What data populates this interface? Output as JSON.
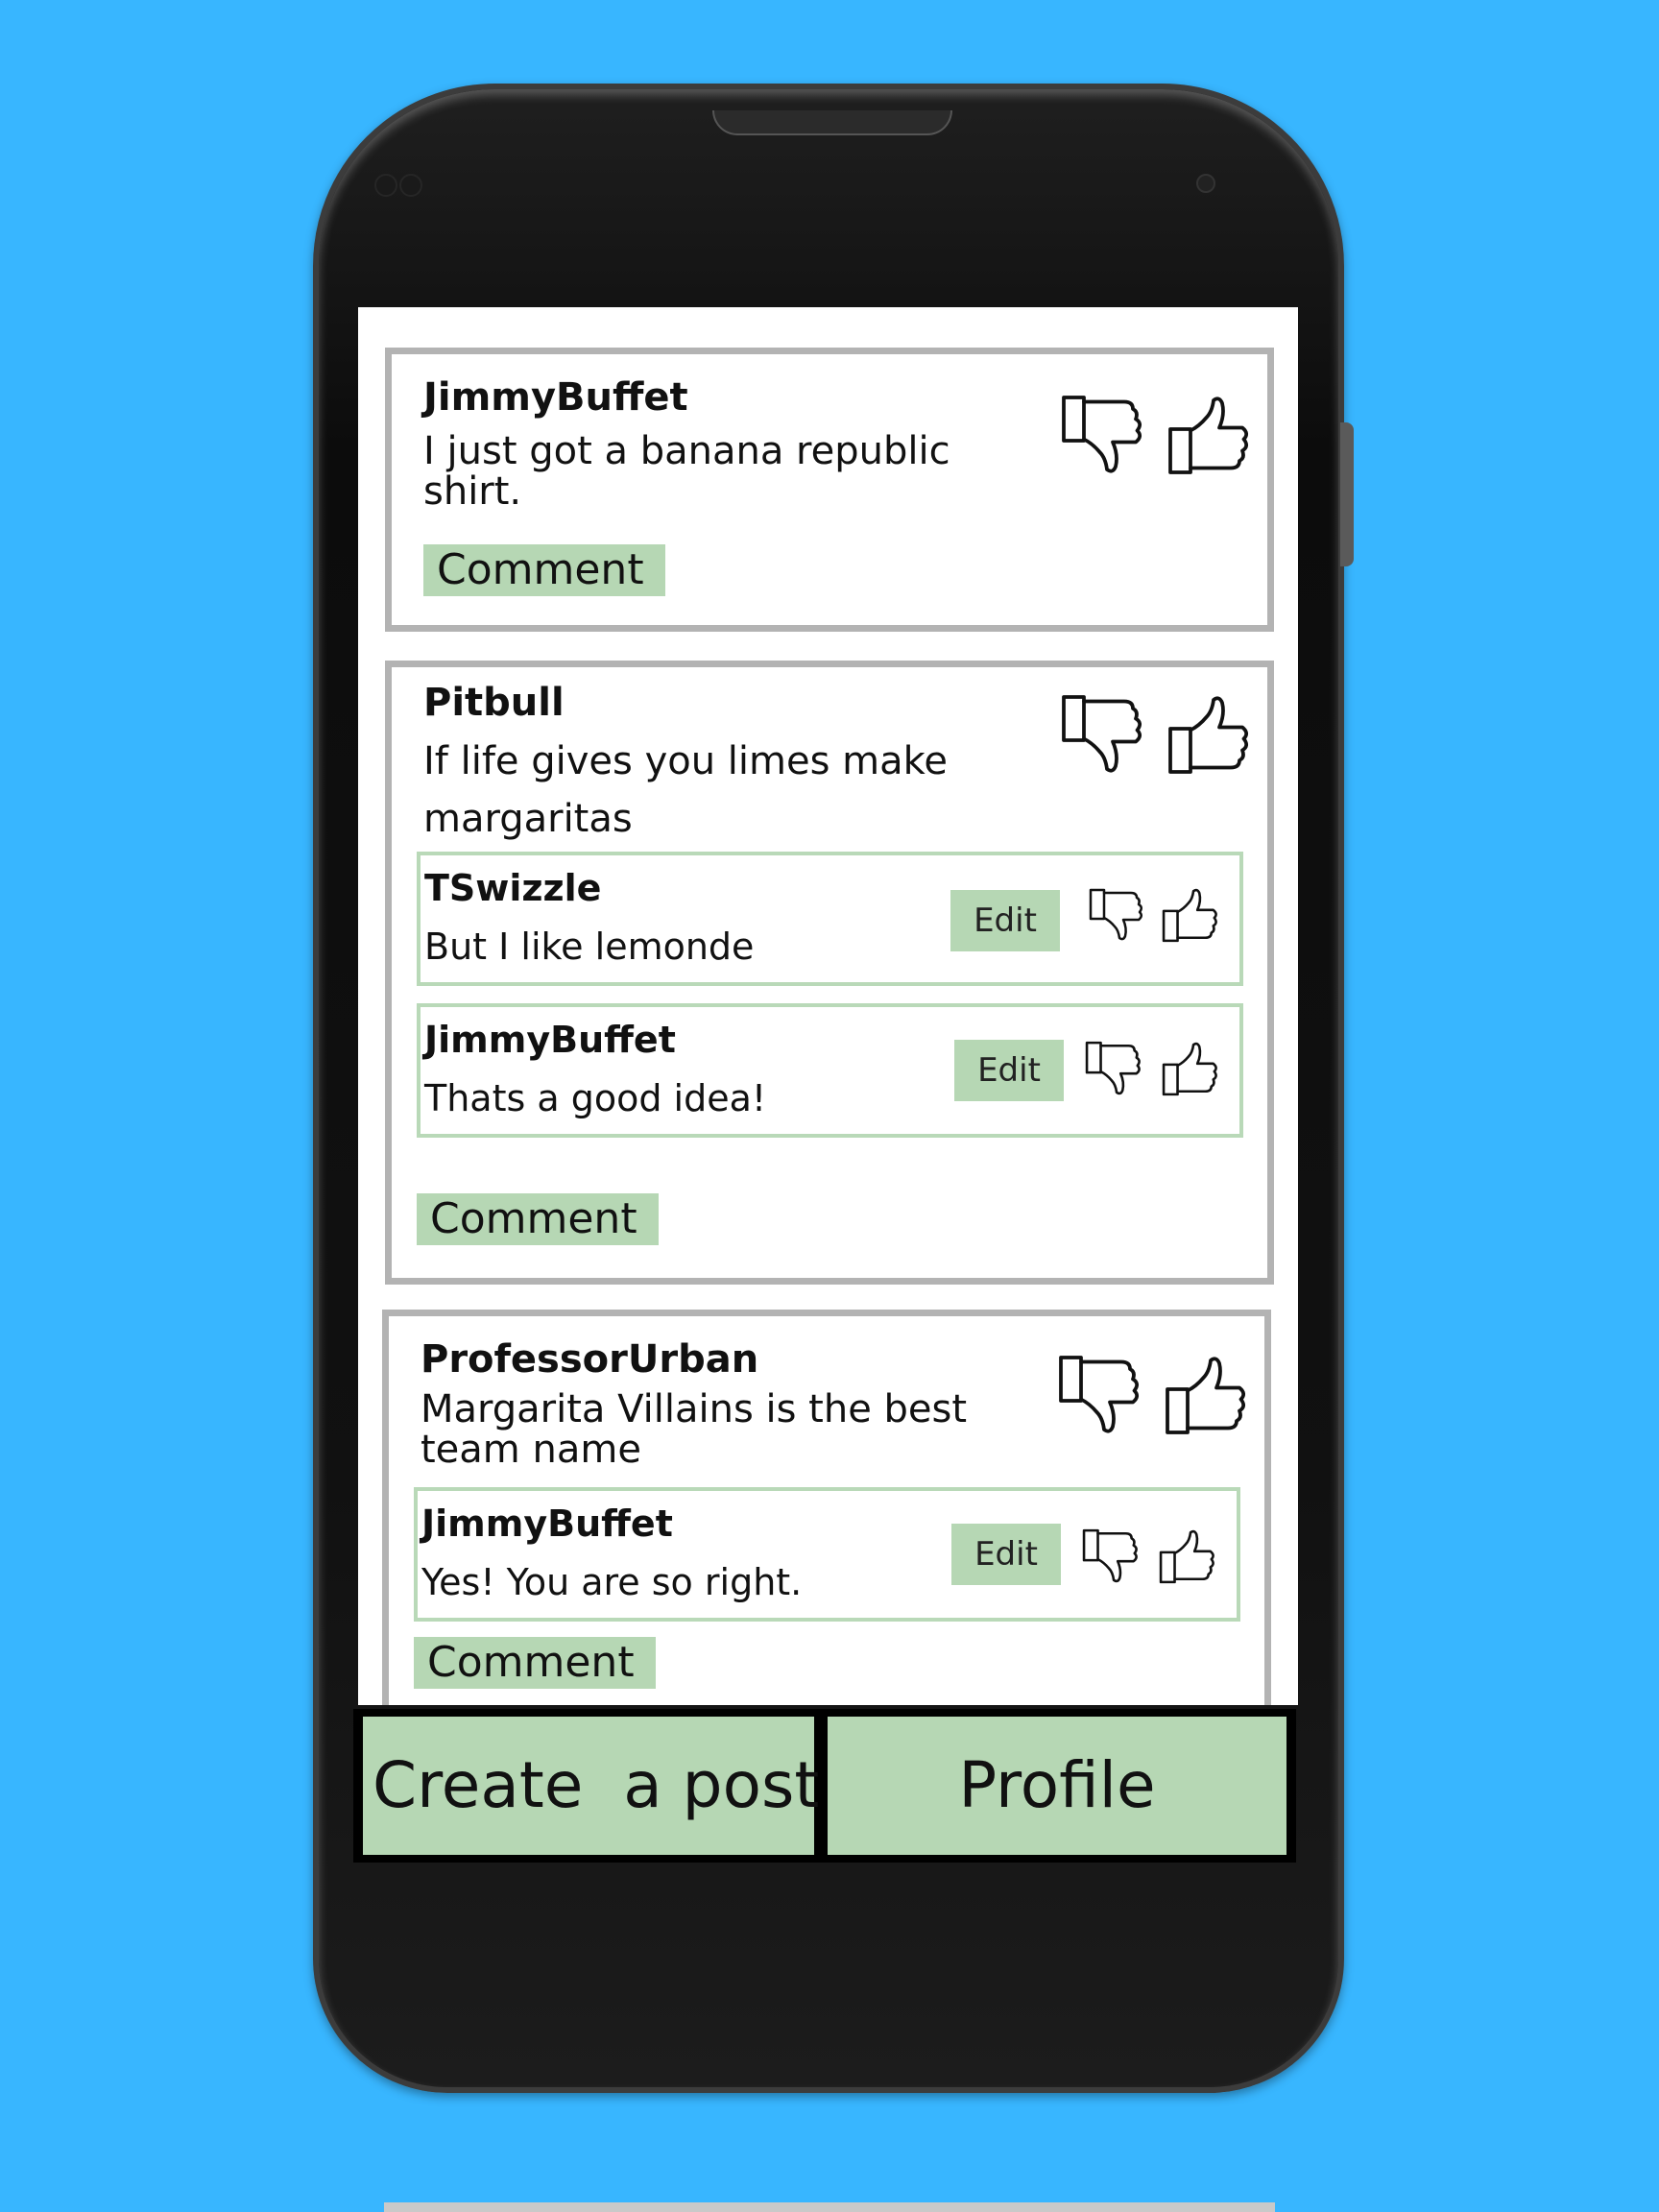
{
  "posts": [
    {
      "author": "JimmyBuffet",
      "text": "I just got a banana republic shirt.",
      "comment_label": "Comment",
      "replies": []
    },
    {
      "author": "Pitbull",
      "text": "If life gives you limes make margaritas",
      "comment_label": "Comment",
      "replies": [
        {
          "author": "TSwizzle",
          "text": "But I like lemonde",
          "edit_label": "Edit"
        },
        {
          "author": "JimmyBuffet",
          "text": "Thats a good idea!",
          "edit_label": "Edit"
        }
      ]
    },
    {
      "author": "ProfessorUrban",
      "text": "Margarita Villains is the best team name",
      "comment_label": "Comment",
      "replies": [
        {
          "author": "JimmyBuffet",
          "text": "Yes! You are so right.",
          "edit_label": "Edit"
        }
      ]
    }
  ],
  "nav": {
    "create_post_label": "Create  a post",
    "profile_label": "Profile"
  },
  "icons": {
    "dislike": "thumbs-down-icon",
    "like": "thumbs-up-icon"
  },
  "colors": {
    "background": "#38b6ff",
    "button_green": "#b6d7b4",
    "post_border": "#b3b3b3",
    "reply_border": "#b9d9b8"
  }
}
